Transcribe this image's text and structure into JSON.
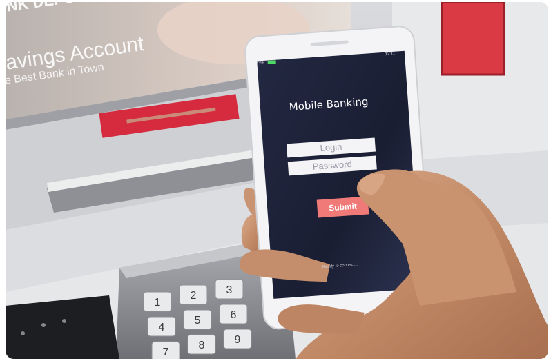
{
  "atm": {
    "banner_partial_line1": "NK DEPOSIT",
    "banner_line2": "avings Account",
    "banner_line3": "e Best Bank in Town",
    "keypad_keys": [
      "1",
      "2",
      "3",
      "4",
      "5",
      "6",
      "7",
      "8",
      "9"
    ]
  },
  "phone": {
    "status_battery": "73%",
    "status_time": "12:11",
    "app_title": "Mobile Banking",
    "login_placeholder": "Login",
    "password_placeholder": "Password",
    "submit_label": "Submit",
    "status_message": "Ready to connect..."
  },
  "colors": {
    "screen_bg": "#1e2236",
    "submit_button": "#f07a78",
    "atm_red_slot": "#d42d3e",
    "atm_panel": "#d8d9dc",
    "skin": "#c8956f"
  }
}
